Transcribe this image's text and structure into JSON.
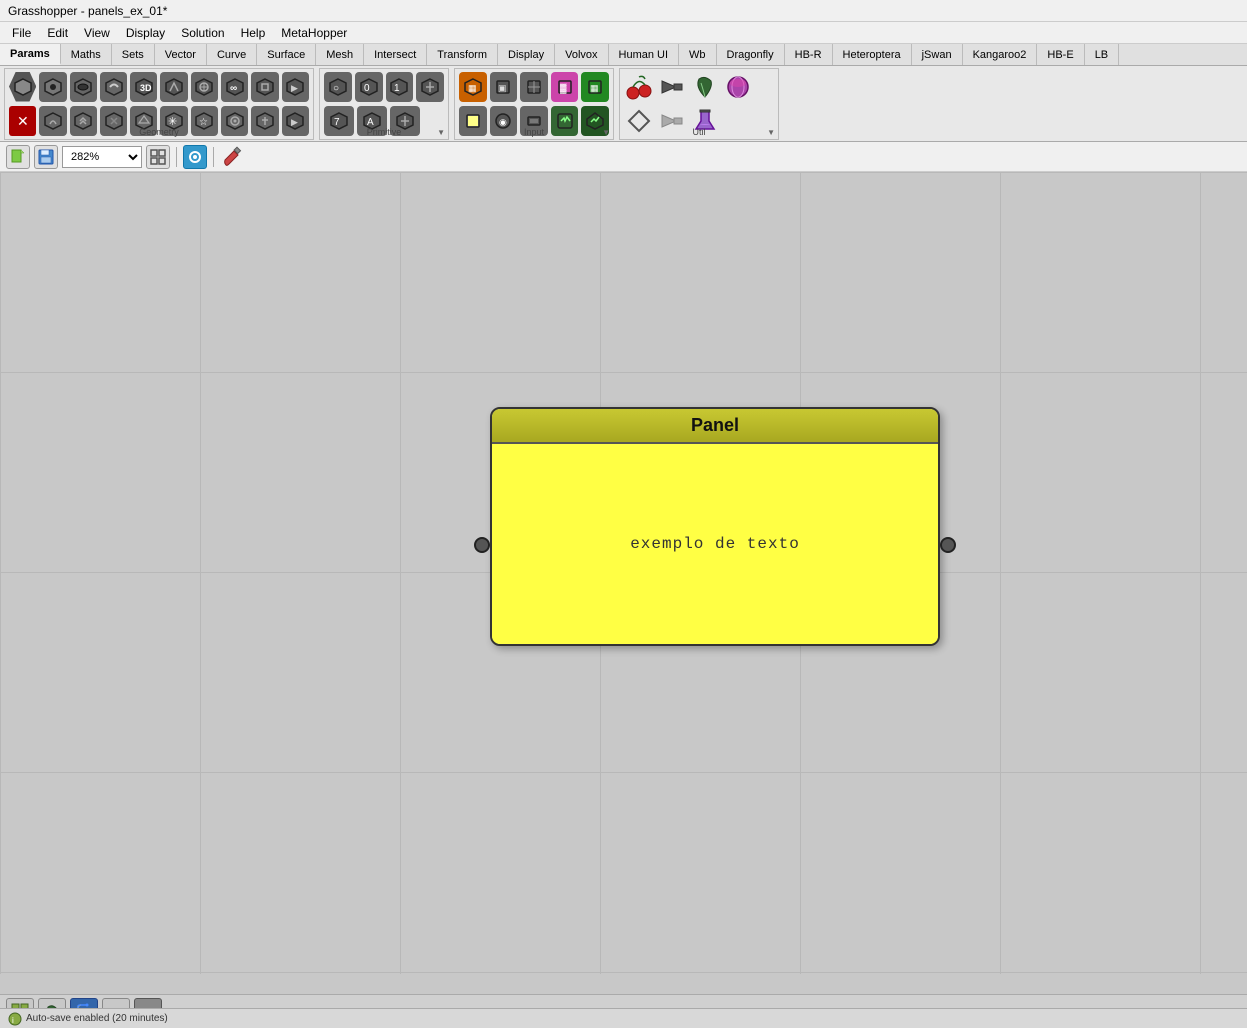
{
  "titleBar": {
    "title": "Grasshopper - panels_ex_01*"
  },
  "menuBar": {
    "items": [
      "File",
      "Edit",
      "View",
      "Display",
      "Solution",
      "Help",
      "MetaHopper"
    ]
  },
  "tabs": [
    {
      "label": "Params",
      "active": true
    },
    {
      "label": "Maths"
    },
    {
      "label": "Sets"
    },
    {
      "label": "Vector"
    },
    {
      "label": "Curve"
    },
    {
      "label": "Surface"
    },
    {
      "label": "Mesh"
    },
    {
      "label": "Intersect"
    },
    {
      "label": "Transform"
    },
    {
      "label": "Display"
    },
    {
      "label": "Volvox"
    },
    {
      "label": "Human UI"
    },
    {
      "label": "Wb"
    },
    {
      "label": "Dragonfly"
    },
    {
      "label": "HB-R"
    },
    {
      "label": "Heteroptera"
    },
    {
      "label": "jSwan"
    },
    {
      "label": "Kangaroo2"
    },
    {
      "label": "HB-E"
    },
    {
      "label": "LB"
    }
  ],
  "toolbarGroups": [
    {
      "name": "Geometry",
      "icons_row1": [
        "⬡",
        "⬡",
        "⬡",
        "⬡",
        "⬡",
        "⬡",
        "⬡",
        "⬡",
        "⬡",
        "⬡"
      ],
      "icons_row2": [
        "⬡",
        "⬡",
        "⬡",
        "⬡",
        "⬡",
        "⬡",
        "⬡",
        "⬡",
        "⬡",
        "⬡"
      ]
    },
    {
      "name": "Primitive",
      "icons_row1": [
        "⬡",
        "⬡",
        "⬡",
        "⬡"
      ],
      "icons_row2": [
        "⬡",
        "⬡",
        "⬡",
        "⬡"
      ]
    },
    {
      "name": "Input",
      "icons_row1": [
        "⬡",
        "⬡",
        "⬡",
        "⬡",
        "⬡"
      ],
      "icons_row2": [
        "⬡",
        "⬡",
        "⬡",
        "⬡",
        "⬡"
      ]
    },
    {
      "name": "Util",
      "icons_row1": [
        "🍒",
        "➡",
        "🌿",
        "🍬"
      ],
      "icons_row2": [
        "⬡",
        "➡",
        "🧪"
      ]
    }
  ],
  "canvasToolbar": {
    "zoomValue": "282%",
    "buttons": [
      "new",
      "save",
      "zoom-fit",
      "zoom-separator",
      "view",
      "view-separator",
      "paint"
    ]
  },
  "panel": {
    "title": "Panel",
    "content": "exemplo de texto"
  },
  "bottomBar": {
    "buttons": [
      "grid-icon",
      "leaf-icon",
      "python-icon",
      "plus-icon",
      "abc-icon"
    ]
  },
  "statusBar": {
    "text": "Auto-save enabled (20 minutes)"
  }
}
